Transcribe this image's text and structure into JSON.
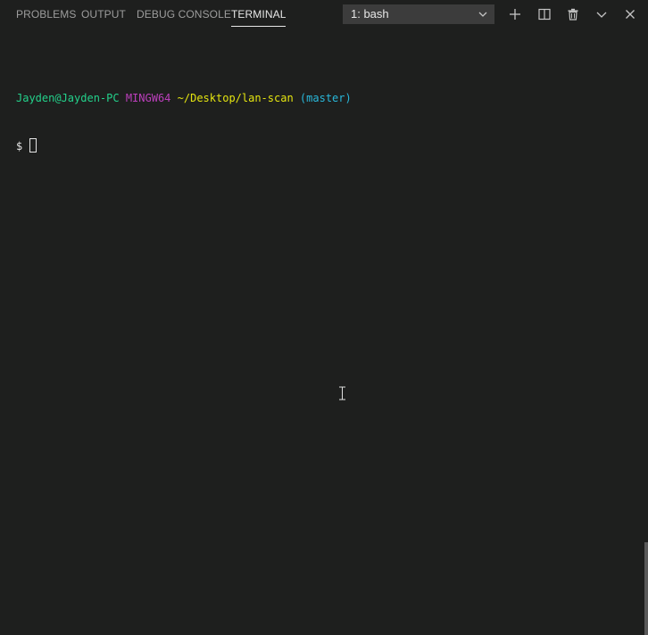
{
  "tabs": [
    {
      "label": "PROBLEMS",
      "active": false
    },
    {
      "label": "OUTPUT",
      "active": false
    },
    {
      "label": "DEBUG CONSOLE",
      "active": false
    },
    {
      "label": "TERMINAL",
      "active": true
    }
  ],
  "terminal_select": {
    "value": "1: bash"
  },
  "actions": [
    "plus-icon",
    "split-icon",
    "trash-icon",
    "chevron-down-icon",
    "close-icon"
  ],
  "terminal": {
    "user_host": "Jayden@Jayden-PC",
    "env": "MINGW64",
    "path": "~/Desktop/lan-scan",
    "branch": "(master)",
    "prompt": "$"
  },
  "colors": {
    "background": "#1e1f1e",
    "green": "#23d18b",
    "magenta": "#bc3fbc",
    "yellow": "#e5e510",
    "cyan": "#29b8db"
  }
}
